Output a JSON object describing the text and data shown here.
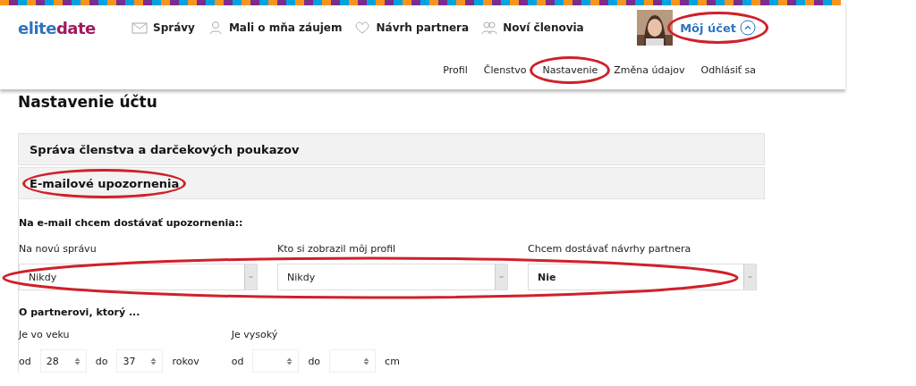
{
  "logo": {
    "first": "elite",
    "second": "date"
  },
  "nav": [
    "Správy",
    "Mali o mňa záujem",
    "Návrh partnera",
    "Noví členovia"
  ],
  "account": {
    "label": "Môj účet",
    "expanded": true
  },
  "submenu": [
    "Profil",
    "Členstvo",
    "Nastavenie",
    "Změna údajov",
    "Odhlásiť sa"
  ],
  "page_title": "Nastavenie účtu",
  "sections": [
    "Správa členstva a darčekových poukazov",
    "E-mailové upozornenia"
  ],
  "email_heading": "Na e-mail chcem dostávať upozornenia::",
  "notifications": [
    {
      "label": "Na novú správu",
      "value": "Nikdy"
    },
    {
      "label": "Kto si zobrazil môj profil",
      "value": "Nikdy"
    },
    {
      "label": "Chcem dostávať návrhy partnera",
      "value": "Nie"
    }
  ],
  "partner_heading": "O partnerovi, ktorý ...",
  "ranges": [
    {
      "label": "Je vo veku",
      "from_label": "od",
      "from": "28",
      "to_label": "do",
      "to": "37",
      "unit": "rokov"
    },
    {
      "label": "Je vysoký",
      "from_label": "od",
      "to_label": "do",
      "unit": "cm"
    }
  ]
}
